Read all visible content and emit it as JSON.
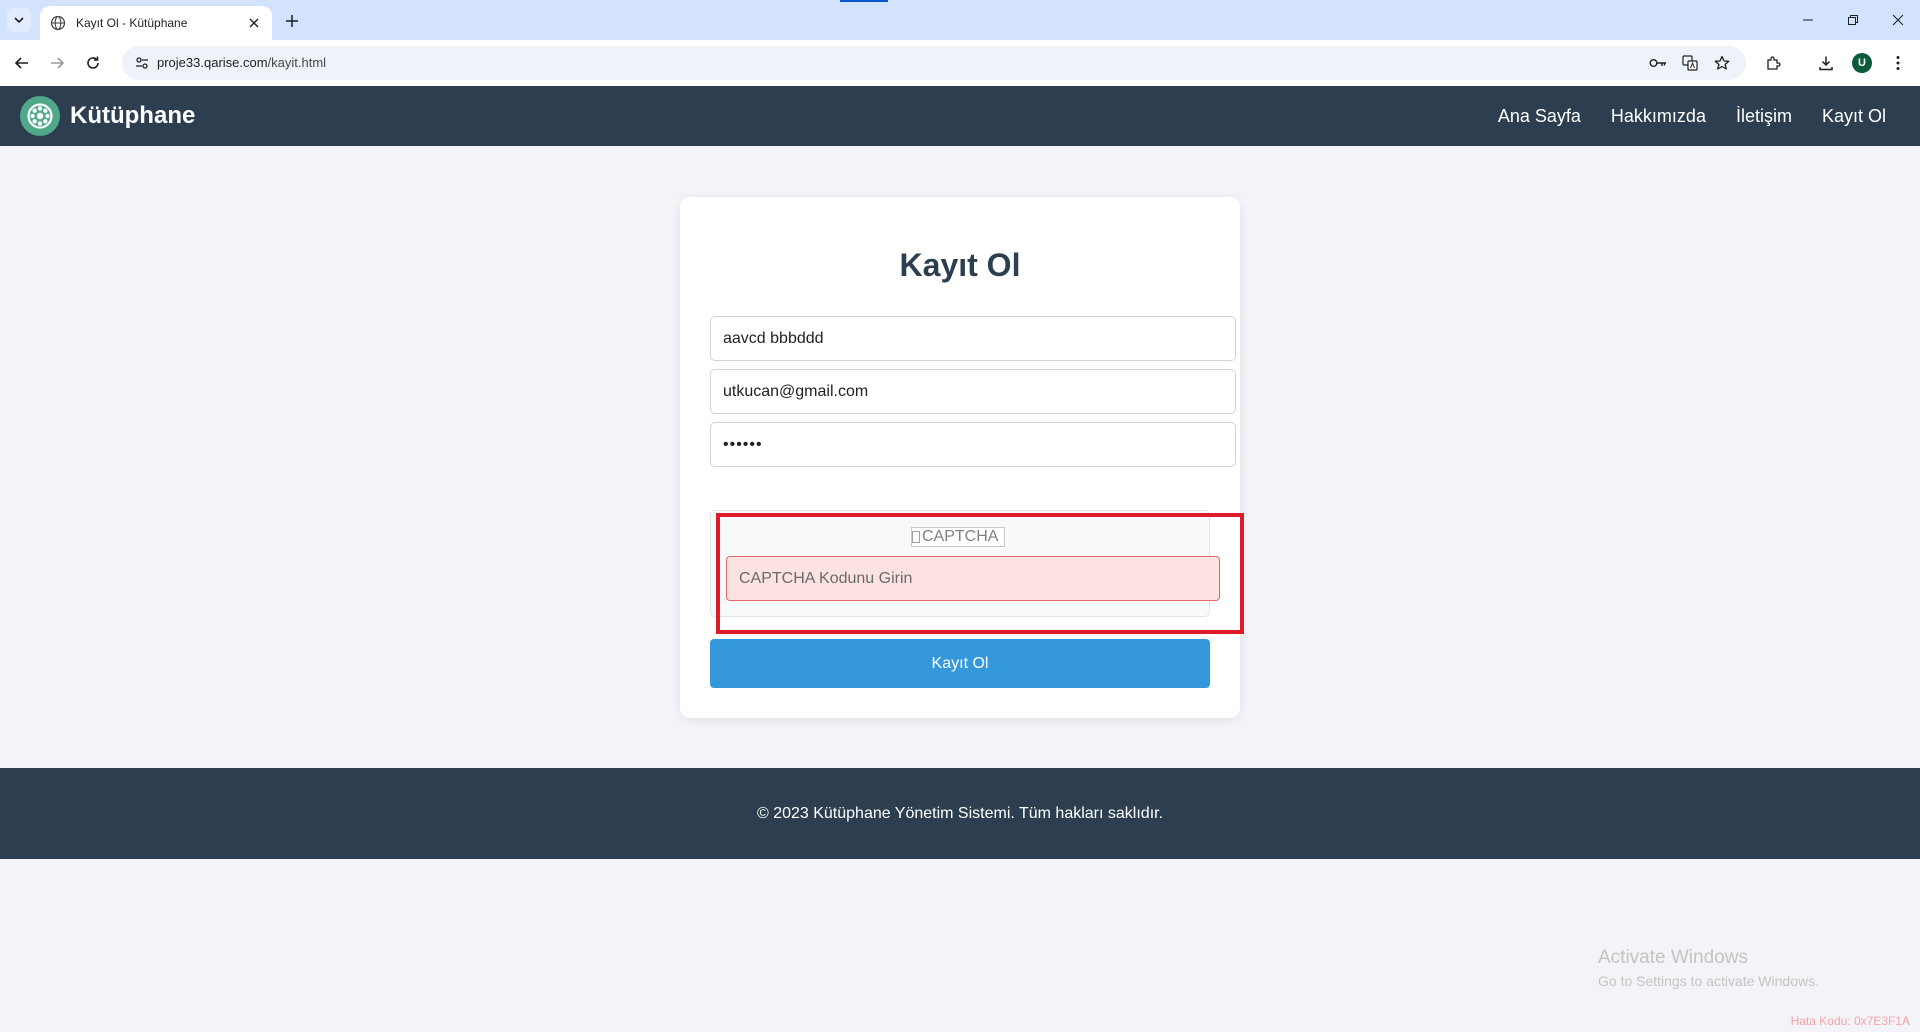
{
  "browser": {
    "tab_title": "Kayıt Ol - Kütüphane",
    "url_host": "proje33.qarise.com",
    "url_path": "/kayit.html",
    "avatar_letter": "U"
  },
  "navbar": {
    "brand": "Kütüphane",
    "links": [
      "Ana Sayfa",
      "Hakkımızda",
      "İletişim",
      "Kayıt Ol"
    ]
  },
  "form": {
    "title": "Kayıt Ol",
    "name_value": "aavcd  bbbddd",
    "email_value": "utkucan@gmail.com",
    "password_value": "••••••",
    "captcha_alt": "CAPTCHA",
    "captcha_placeholder": "CAPTCHA Kodunu Girin",
    "submit_label": "Kayıt Ol"
  },
  "footer": {
    "text": "© 2023 Kütüphane Yönetim Sistemi. Tüm hakları saklıdır."
  },
  "watermark": {
    "title": "Activate Windows",
    "subtitle": "Go to Settings to activate Windows."
  },
  "error_code": "Hata Kodu: 0x7E3F1A",
  "colors": {
    "navbar": "#2c3e50",
    "button": "#3498db",
    "highlight": "#dd1c2b",
    "captcha_input_bg": "#fde2e2"
  }
}
